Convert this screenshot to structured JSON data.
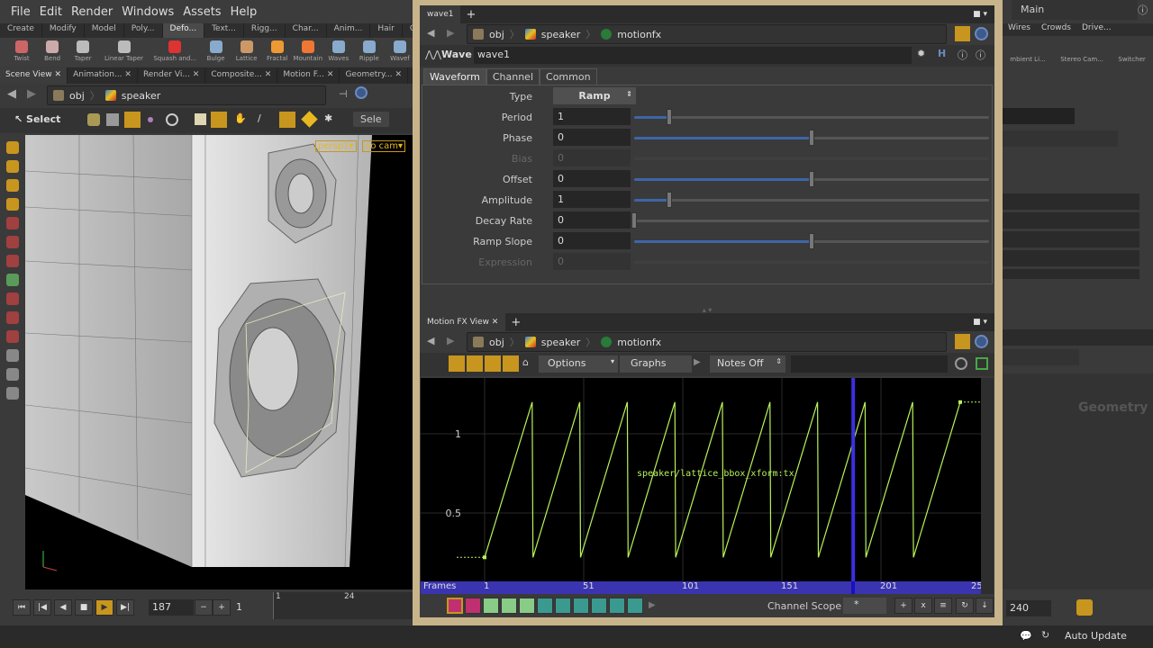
{
  "menu": [
    "File",
    "Edit",
    "Render",
    "Windows",
    "Assets",
    "Help"
  ],
  "shelf_tabs": [
    "Create",
    "Modify",
    "Model",
    "Poly...",
    "Defo...",
    "Text...",
    "Rigg...",
    "Char...",
    "Anim...",
    "Hair",
    "Groo"
  ],
  "shelf_tools": [
    "Twist",
    "Bend",
    "Taper",
    "Linear Taper",
    "Squash and...",
    "Bulge",
    "Lattice",
    "Fractal",
    "Mountain",
    "Waves",
    "Ripple",
    "Wavef"
  ],
  "pane_tabs": [
    "Scene View",
    "Animation...",
    "Render Vi...",
    "Composite...",
    "Motion F...",
    "Geometry..."
  ],
  "scene": {
    "path_obj": "obj",
    "path_node": "speaker",
    "select_label": "Select",
    "sele_btn": "Sele",
    "persp": "persp1▾",
    "cam": "no cam▾"
  },
  "timeline": {
    "frame": "187",
    "step": "1",
    "start": "1",
    "tick": "24"
  },
  "right": {
    "desktop": "Main",
    "tabs": [
      "Wires",
      "Crowds",
      "Drive..."
    ],
    "tools": [
      "mbient Li...",
      "Stereo Cam...",
      "Switcher"
    ],
    "frame_end": "240",
    "geometry_label": "Geometry"
  },
  "params": {
    "tab": "wave1",
    "path_obj": "obj",
    "path_speaker": "speaker",
    "path_node": "motionfx",
    "node_type": "Wave",
    "node_name": "wave1",
    "tabs": [
      "Waveform",
      "Channel",
      "Common"
    ],
    "type_label": "Type",
    "type_value": "Ramp",
    "rows": [
      {
        "label": "Period",
        "value": "1",
        "slider": 0.1
      },
      {
        "label": "Phase",
        "value": "0",
        "slider": 0.5
      },
      {
        "label": "Bias",
        "value": "0",
        "disabled": true
      },
      {
        "label": "Offset",
        "value": "0",
        "slider": 0.5
      },
      {
        "label": "Amplitude",
        "value": "1",
        "slider": 0.1
      },
      {
        "label": "Decay Rate",
        "value": "0",
        "slider": 0
      },
      {
        "label": "Ramp Slope",
        "value": "0",
        "slider": 0.5
      },
      {
        "label": "Expression",
        "value": "0",
        "disabled": true
      }
    ]
  },
  "motionfx": {
    "tab": "Motion FX View",
    "path_obj": "obj",
    "path_speaker": "speaker",
    "path_node": "motionfx",
    "options": "Options",
    "graphs": "Graphs",
    "notes": "Notes Off",
    "channel_scope_label": "Channel Scope",
    "channel_scope_value": "*"
  },
  "chart_data": {
    "type": "line",
    "title": "speaker/lattice_bbox_xform:tx",
    "xlabel": "Frames",
    "x_ticks": [
      "1",
      "51",
      "101",
      "151",
      "201",
      "25"
    ],
    "y_ticks": [
      "1",
      "0.5"
    ],
    "xlim": [
      1,
      250
    ],
    "ylim": [
      0.2,
      1.2
    ],
    "current_frame": 187,
    "series": [
      {
        "name": "speaker/lattice_bbox_xform:tx",
        "color": "#b8f25a",
        "x": [
          1,
          25,
          25.4,
          49,
          49.4,
          73,
          73.4,
          97,
          97.4,
          121,
          121.4,
          145,
          145.4,
          169,
          169.4,
          193,
          193.4,
          217,
          217.4,
          241
        ],
        "y": [
          0.22,
          1.2,
          0.22,
          1.2,
          0.22,
          1.2,
          0.22,
          1.2,
          0.22,
          1.2,
          0.22,
          1.2,
          0.22,
          1.2,
          0.22,
          1.2,
          0.22,
          1.2,
          0.22,
          1.2
        ]
      }
    ]
  },
  "status": {
    "auto_update": "Auto Update"
  }
}
